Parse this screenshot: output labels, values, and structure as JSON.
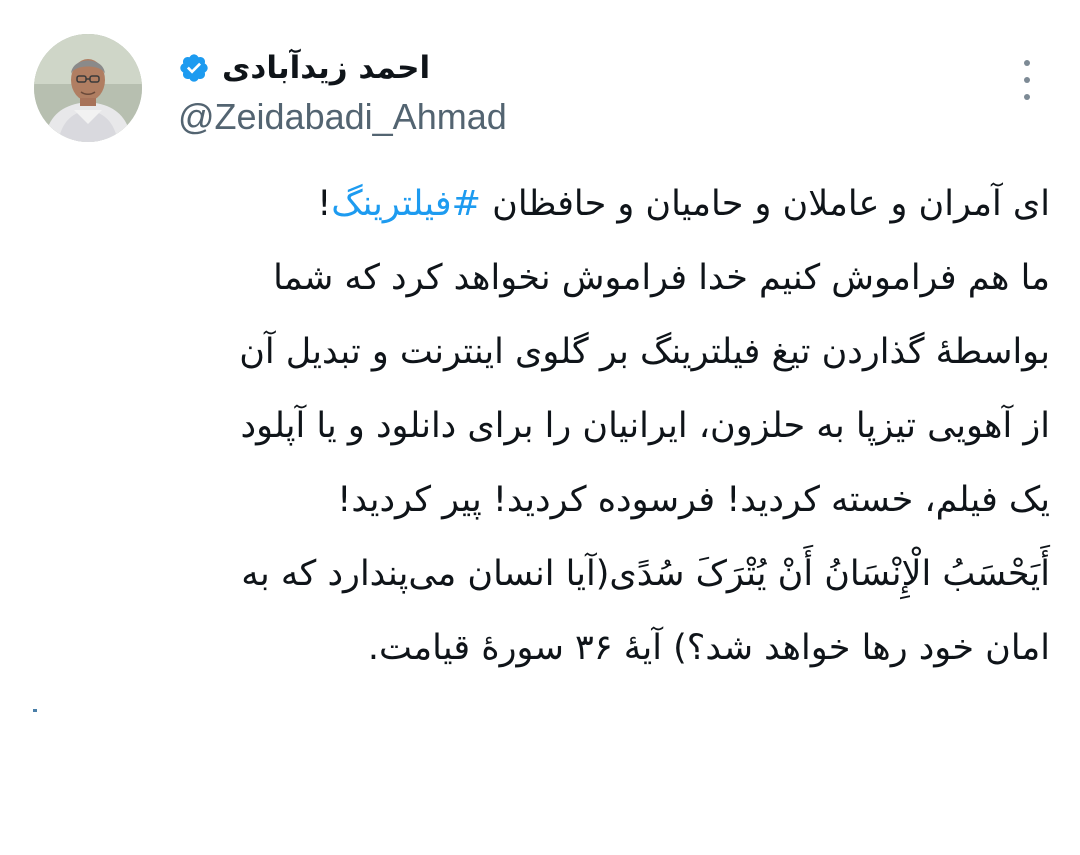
{
  "author": {
    "display_name": "احمد زیدآبادی",
    "handle": "@Zeidabadi_Ahmad",
    "verified": true,
    "avatar_icon": "profile-photo",
    "verified_icon": "verified-badge-icon",
    "verified_color": "#1d9bf0"
  },
  "menu": {
    "icon": "more-options-icon"
  },
  "tweet": {
    "line1_before": "ای آمران و عاملان و حامیان و حافظان ",
    "hashtag": "#فیلترینگ",
    "line1_after": "!",
    "line2": "ما هم فراموش کنیم خدا فراموش نخواهد کرد که شما",
    "line3": "بواسطۀ گذاردن تیغ فیلترینگ بر گلوی اینترنت و تبدیل آن",
    "line4": "از آهویی تیزپا به حلزون، ایرانیان را برای دانلود و یا آپلود",
    "line5": "یک فیلم، خسته کردید! فرسوده کردید! پیر کردید!",
    "line6": "أَیَحْسَبُ الْإِنْسَانُ أَنْ یُتْرَکَ سُدًی(آیا انسان می‌پندارد که به",
    "line7": "امان خود رها خواهد شد؟) آیۀ ۳۶ سورۀ قیامت."
  },
  "colors": {
    "text": "#0f1419",
    "handle": "#536471",
    "link": "#1d9bf0",
    "background": "#ffffff"
  }
}
